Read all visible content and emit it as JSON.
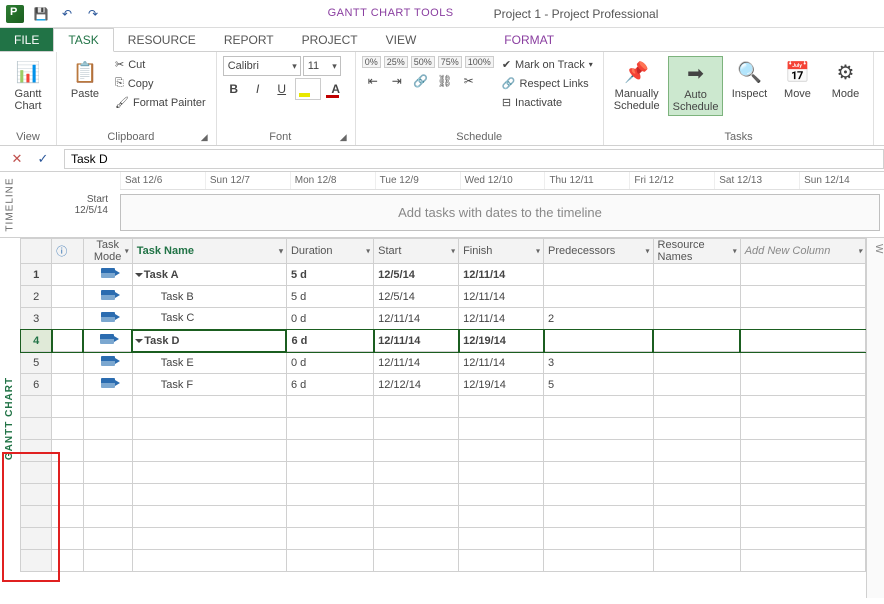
{
  "titlebar": {
    "context_tools": "GANTT CHART TOOLS",
    "window_title": "Project 1 - Project Professional"
  },
  "tabs": {
    "file": "FILE",
    "task": "TASK",
    "resource": "RESOURCE",
    "report": "REPORT",
    "project": "PROJECT",
    "view": "VIEW",
    "format": "FORMAT"
  },
  "ribbon": {
    "view": {
      "gantt_chart": "Gantt\nChart",
      "group": "View"
    },
    "clipboard": {
      "paste": "Paste",
      "cut": "Cut",
      "copy": "Copy",
      "format_painter": "Format Painter",
      "group": "Clipboard"
    },
    "font": {
      "name": "Calibri",
      "size": "11",
      "group": "Font"
    },
    "schedule": {
      "percents": [
        "0%",
        "25%",
        "50%",
        "75%",
        "100%"
      ],
      "mark_on_track": "Mark on Track",
      "respect_links": "Respect Links",
      "inactivate": "Inactivate",
      "group": "Schedule"
    },
    "tasks": {
      "manual": "Manually\nSchedule",
      "auto": "Auto\nSchedule",
      "inspect": "Inspect",
      "move": "Move",
      "mode": "Mode",
      "group": "Tasks"
    }
  },
  "formula_bar": {
    "value": "Task D"
  },
  "timeline": {
    "side_label": "TIMELINE",
    "start_label": "Start",
    "start_date": "12/5/14",
    "dates": [
      "Sat 12/6",
      "Sun 12/7",
      "Mon 12/8",
      "Tue 12/9",
      "Wed 12/10",
      "Thu 12/11",
      "Fri 12/12",
      "Sat 12/13",
      "Sun 12/14"
    ],
    "placeholder": "Add tasks with dates to the timeline"
  },
  "grid": {
    "side_label": "GANTT CHART",
    "headers": {
      "info": "",
      "mode": "Task\nMode",
      "name": "Task Name",
      "duration": "Duration",
      "start": "Start",
      "finish": "Finish",
      "pred": "Predecessors",
      "res": "Resource\nNames",
      "add": "Add New Column"
    },
    "rows": [
      {
        "num": "1",
        "name": "Task A",
        "indent": 0,
        "summary": true,
        "dur": "5 d",
        "start": "12/5/14",
        "finish": "12/11/14",
        "pred": "",
        "bold": true
      },
      {
        "num": "2",
        "name": "Task B",
        "indent": 1,
        "summary": false,
        "dur": "5 d",
        "start": "12/5/14",
        "finish": "12/11/14",
        "pred": ""
      },
      {
        "num": "3",
        "name": "Task C",
        "indent": 1,
        "summary": false,
        "dur": "0 d",
        "start": "12/11/14",
        "finish": "12/11/14",
        "pred": "2"
      },
      {
        "num": "4",
        "name": "Task D",
        "indent": 0,
        "summary": true,
        "dur": "6 d",
        "start": "12/11/14",
        "finish": "12/19/14",
        "pred": "",
        "bold": true,
        "selected": true
      },
      {
        "num": "5",
        "name": "Task E",
        "indent": 1,
        "summary": false,
        "dur": "0 d",
        "start": "12/11/14",
        "finish": "12/11/14",
        "pred": "3"
      },
      {
        "num": "6",
        "name": "Task F",
        "indent": 1,
        "summary": false,
        "dur": "6 d",
        "start": "12/12/14",
        "finish": "12/19/14",
        "pred": "5"
      }
    ],
    "right_header_fragment": "W"
  }
}
